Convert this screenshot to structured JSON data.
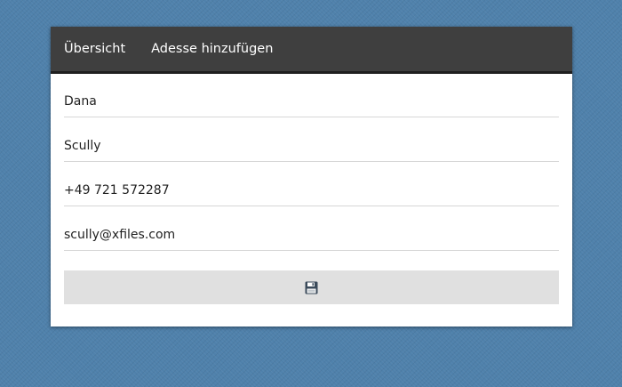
{
  "nav": {
    "items": [
      {
        "label": "Übersicht"
      },
      {
        "label": "Adesse hinzufügen"
      }
    ]
  },
  "form": {
    "first_name": {
      "value": "Dana"
    },
    "last_name": {
      "value": "Scully"
    },
    "phone": {
      "value": "+49 721 572287"
    },
    "email": {
      "value": "scully@xfiles.com"
    },
    "save_button": {
      "icon": "floppy-disk-icon"
    }
  },
  "colors": {
    "background": "#4f81ab",
    "navbar": "#3f3f3f",
    "button": "#e0e0e0"
  }
}
